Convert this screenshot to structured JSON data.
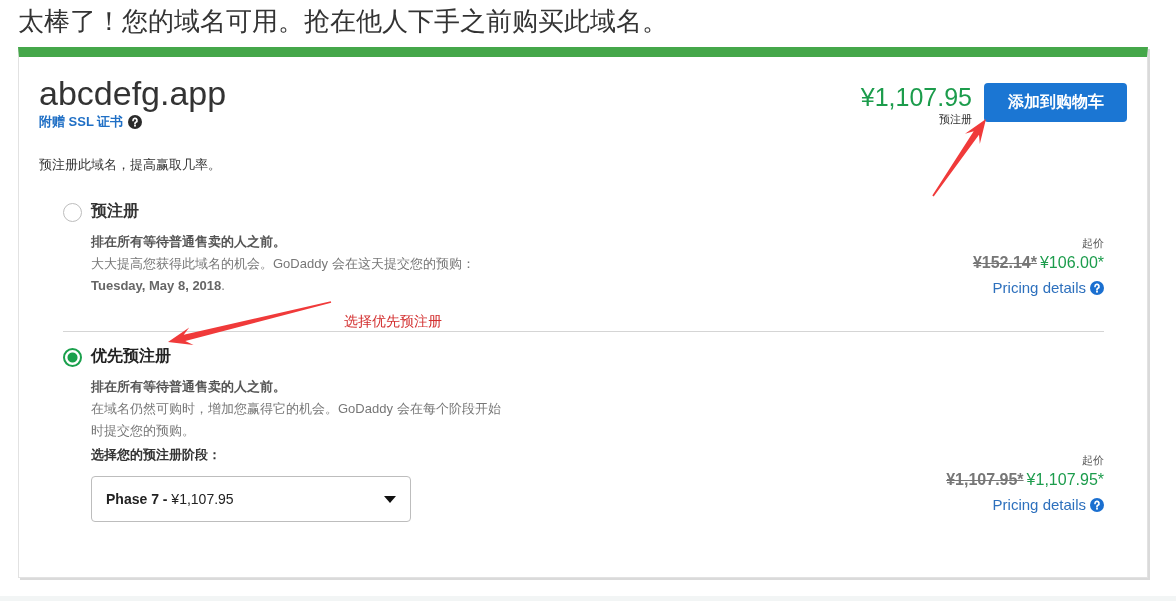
{
  "headline": "太棒了！您的域名可用。抢在他人下手之前购买此域名。",
  "domain": {
    "name": "abcdefg.app",
    "bonus_link": "附赠 SSL 证书",
    "price": "¥1,107.95",
    "price_label": "预注册",
    "add_to_cart": "添加到购物车"
  },
  "intro": "预注册此域名，提高赢取几率。",
  "options": [
    {
      "title": "预注册",
      "selected": false,
      "highlight": "排在所有等待普通售卖的人之前。",
      "description": "大大提高您获得此域名的机会。GoDaddy 会在这天提交您的预购：**Tuesday, May 8, 2018**.",
      "price_caption": "起价",
      "old_price": "¥152.14*",
      "new_price": "¥106.00*",
      "details_link": "Pricing details"
    },
    {
      "title": "优先预注册",
      "selected": true,
      "highlight": "排在所有等待普通售卖的人之前。",
      "description": "在域名仍然可购时，增加您赢得它的机会。GoDaddy 会在每个阶段开始时提交您的预购。",
      "phase_label": "选择您的预注册阶段：",
      "phase_select": {
        "value": "**Phase 7 -** ¥1,107.95"
      },
      "price_caption": "起价",
      "old_price": "¥1,107.95*",
      "new_price": "¥1,107.95*",
      "details_link": "Pricing details"
    }
  ],
  "annotation": {
    "label": "选择优先预注册"
  }
}
